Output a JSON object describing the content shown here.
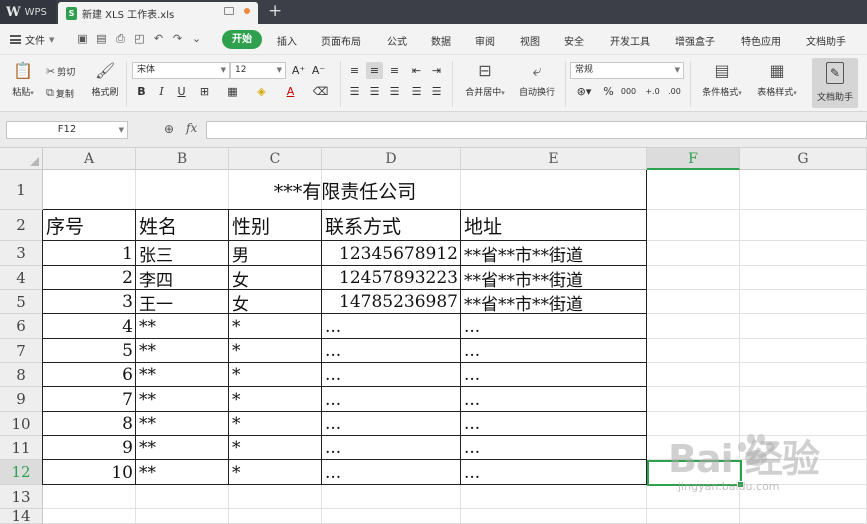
{
  "titlebar": {
    "app": "WPS",
    "doc_tab": "新建 XLS 工作表.xls"
  },
  "menubar": {
    "file": "文件",
    "start": "开始",
    "items": [
      "插入",
      "页面布局",
      "公式",
      "数据",
      "审阅",
      "视图",
      "安全",
      "开发工具",
      "增强盒子",
      "特色应用",
      "文档助手"
    ]
  },
  "ribbon": {
    "paste": "粘贴",
    "cut": "剪切",
    "copy": "复制",
    "format_painter": "格式刷",
    "font_name": "宋体",
    "font_size": "12",
    "merge_center": "合并居中",
    "wrap_text": "自动换行",
    "number_format": "常规",
    "conditional_format": "条件格式",
    "table_style": "表格样式",
    "doc_helper": "文档助手"
  },
  "formula_bar": {
    "cell_ref": "F12",
    "formula": ""
  },
  "columns": [
    "A",
    "B",
    "C",
    "D",
    "E",
    "F",
    "G"
  ],
  "rows": [
    "1",
    "2",
    "3",
    "4",
    "5",
    "6",
    "7",
    "8",
    "9",
    "10",
    "11",
    "12",
    "13",
    "14"
  ],
  "sheet": {
    "title": "***有限责任公司",
    "headers": [
      "序号",
      "姓名",
      "性别",
      "联系方式",
      "地址"
    ],
    "records": [
      [
        "1",
        "张三",
        "男",
        "12345678912",
        "**省**市**街道"
      ],
      [
        "2",
        "李四",
        "女",
        "12457893223",
        "**省**市**街道"
      ],
      [
        "3",
        "王一",
        "女",
        "14785236987",
        "**省**市**街道"
      ],
      [
        "4",
        "**",
        "*",
        "...",
        "..."
      ],
      [
        "5",
        "**",
        "*",
        "...",
        "..."
      ],
      [
        "6",
        "**",
        "*",
        "...",
        "..."
      ],
      [
        "7",
        "**",
        "*",
        "...",
        "..."
      ],
      [
        "8",
        "**",
        "*",
        "...",
        "..."
      ],
      [
        "9",
        "**",
        "*",
        "...",
        "..."
      ],
      [
        "10",
        "**",
        "*",
        "...",
        "..."
      ]
    ]
  },
  "selection": {
    "column": "F",
    "row": "12"
  },
  "watermark": {
    "brand": "Bai 经验",
    "url": "jingyan.baidu.com"
  },
  "colors": {
    "accent": "#2fa14e",
    "titlebar": "#3c3f48"
  }
}
